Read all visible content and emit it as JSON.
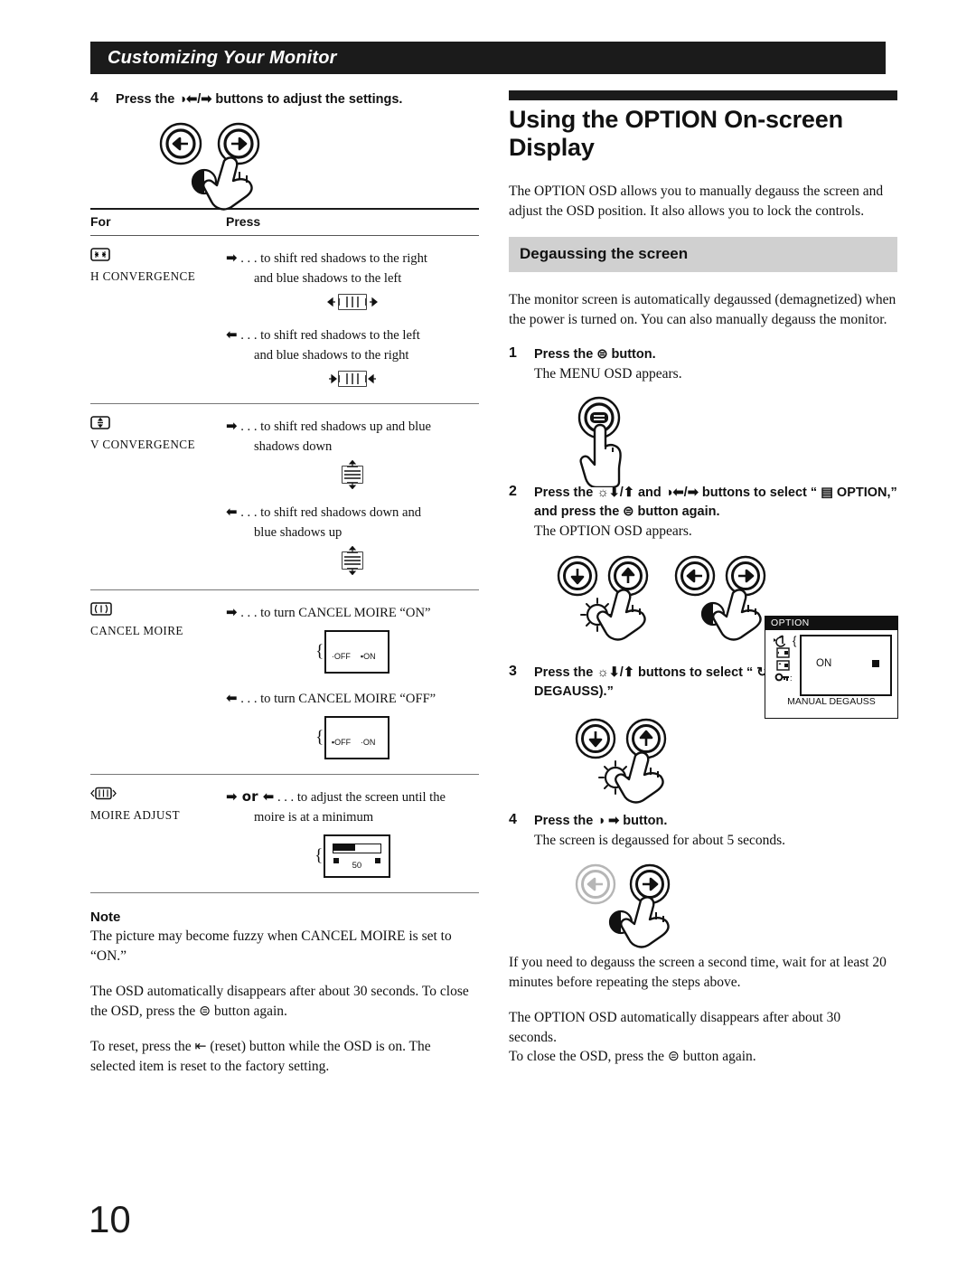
{
  "runhead": {
    "title": "Customizing Your Monitor"
  },
  "page_number": "10",
  "left": {
    "step4": {
      "num": "4",
      "text": "Press the ◑⬅/➡ buttons to adjust the settings."
    },
    "table": {
      "headers": {
        "for": "For",
        "press": "Press"
      },
      "rows": [
        {
          "icon": "h-convergence-icon",
          "label": "H CONVERGENCE",
          "entries": [
            {
              "arrow": "➡",
              "lead": ". . . to shift red shadows to the right",
              "cont": "and blue shadows to the left",
              "illustration": "h-convergence-left-right"
            },
            {
              "arrow": "⬅",
              "lead": ". . . to shift red shadows to the left",
              "cont": "and blue shadows to the right",
              "illustration": "h-convergence-right-left"
            }
          ]
        },
        {
          "icon": "v-convergence-icon",
          "label": "V CONVERGENCE",
          "entries": [
            {
              "arrow": "➡",
              "lead": ". . . to shift red shadows up and blue",
              "cont": "shadows down",
              "illustration": "v-convergence-up-down"
            },
            {
              "arrow": "⬅",
              "lead": ". . . to shift red shadows down and",
              "cont": "blue shadows up",
              "illustration": "v-convergence-down-up"
            }
          ]
        },
        {
          "icon": "cancel-moire-icon",
          "label": "CANCEL MOIRE",
          "entries": [
            {
              "arrow": "➡",
              "lead": ". . . to turn CANCEL MOIRE “ON”",
              "cont": "",
              "illustration": "onoff-on",
              "off_label": "OFF",
              "on_label": "ON"
            },
            {
              "arrow": "⬅",
              "lead": ". . . to turn CANCEL MOIRE “OFF”",
              "cont": "",
              "illustration": "onoff-off",
              "off_label": "OFF",
              "on_label": "ON"
            }
          ]
        },
        {
          "icon": "moire-adjust-icon",
          "label": "MOIRE ADJUST",
          "entries": [
            {
              "arrow": "➡ or ⬅",
              "lead": ". . . to adjust the screen until the",
              "cont": "moire is at a minimum",
              "illustration": "slider",
              "slider_value": "50"
            }
          ]
        }
      ]
    },
    "note": {
      "heading": "Note",
      "text": "The picture may become fuzzy when CANCEL MOIRE is set to “ON.”"
    },
    "para_osd_auto": "The OSD automatically disappears after about 30 seconds. To close the OSD, press the ⊜ button again.",
    "para_reset": "To reset,  press the ⇤ (reset) button while the OSD is on. The selected item is reset to the factory setting."
  },
  "right": {
    "section_title": "Using the OPTION On-screen Display",
    "intro": "The OPTION OSD allows you to manually degauss the screen and adjust  the OSD position. It also allows you to lock the controls.",
    "subhead": "Degaussing the screen",
    "degauss_intro": "The monitor screen is automatically degaussed (demagnetized) when the power is turned on. You can also manually degauss the monitor.",
    "steps": [
      {
        "num": "1",
        "text": "Press the ⊜ button.",
        "sub": "The MENU OSD appears."
      },
      {
        "num": "2",
        "text": "Press the ☼⬇/⬆ and ◑⬅/➡ buttons to select “ ▤ OPTION,” and press the ⊜ button again.",
        "sub": "The OPTION OSD appears."
      },
      {
        "num": "3",
        "text": "Press the ☼⬇/⬆ buttons to select “ ↻  (MANUAL DEGAUSS).”",
        "sub": ""
      },
      {
        "num": "4",
        "text": "Press the ◑ ➡ button.",
        "sub": "The screen is degaussed for about 5 seconds."
      }
    ],
    "osd_panel": {
      "title": "OPTION",
      "value": "ON",
      "caption": "MANUAL DEGAUSS"
    },
    "para_second_time": "If you need to degauss the screen a second time, wait for at least 20 minutes before repeating the steps above.",
    "para_auto_close": "The OPTION OSD automatically disappears after about 30 seconds. seconds.",
    "para_auto_close_line1": "The OPTION OSD automatically disappears after about 30",
    "para_auto_close_line2": "seconds.",
    "para_auto_close_line3": "To close the OSD, press the ⊜ button again."
  }
}
